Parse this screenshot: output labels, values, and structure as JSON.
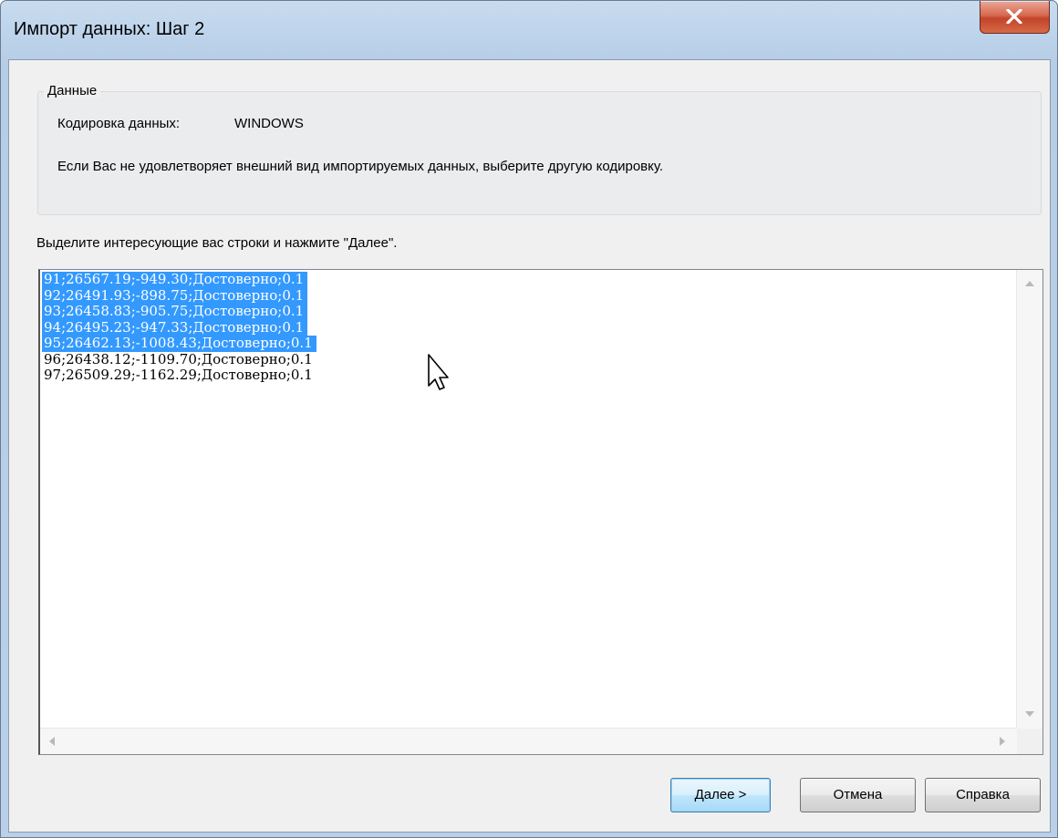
{
  "window": {
    "title": "Импорт данных: Шаг 2"
  },
  "data_group": {
    "legend": "Данные",
    "encoding_label": "Кодировка данных:",
    "encoding_value": "WINDOWS",
    "hint": "Если Вас не удовлетворяет внешний вид импортируемых данных, выберите другую кодировку."
  },
  "instruction": "Выделите интересующие вас строки и нажмите \"Далее\".",
  "preview_lines": [
    {
      "text": "91;26567.19;-949.30;Достоверно;0.1",
      "selected": true
    },
    {
      "text": "92;26491.93;-898.75;Достоверно;0.1",
      "selected": true
    },
    {
      "text": "93;26458.83;-905.75;Достоверно;0.1",
      "selected": true
    },
    {
      "text": "94;26495.23;-947.33;Достоверно;0.1",
      "selected": true
    },
    {
      "text": "95;26462.13;-1008.43;Достоверно;0.1",
      "selected": true
    },
    {
      "text": "96;26438.12;-1109.70;Достоверно;0.1",
      "selected": false
    },
    {
      "text": "97;26509.29;-1162.29;Достоверно;0.1",
      "selected": false
    }
  ],
  "buttons": {
    "next": "Далее >",
    "cancel": "Отмена",
    "help": "Справка"
  },
  "colors": {
    "selection": "#3399ff",
    "close_button": "#c2442a"
  },
  "icons": {
    "close": "close-icon",
    "cursor": "mouse-pointer-icon"
  }
}
